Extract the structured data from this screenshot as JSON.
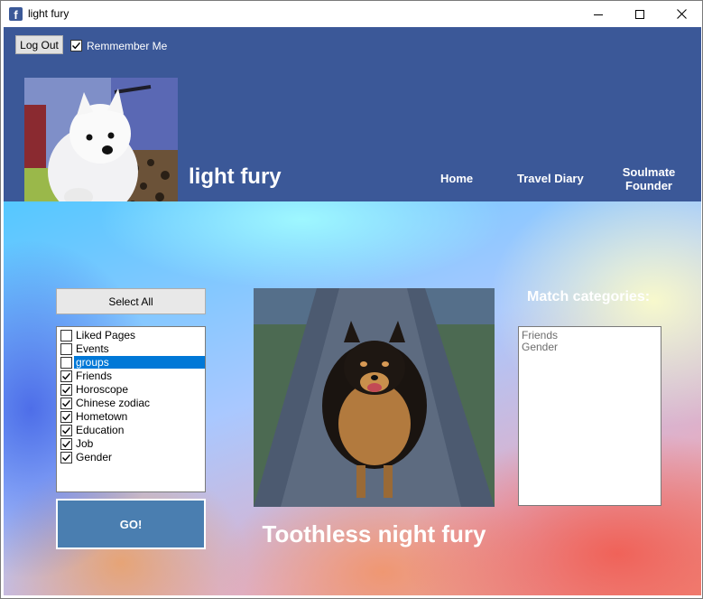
{
  "window": {
    "title": "light fury",
    "app_icon": "facebook-icon",
    "controls": [
      "minimize-icon",
      "maximize-icon",
      "close-icon"
    ]
  },
  "header": {
    "logout_label": "Log Out",
    "remember_label": "Remmember Me",
    "remember_checked": true,
    "profile_name": "light fury",
    "nav": [
      "Home",
      "Travel Diary",
      "Soulmate Founder"
    ]
  },
  "main": {
    "select_all_label": "Select All",
    "categories": [
      {
        "label": "Liked Pages",
        "checked": false,
        "selected": false
      },
      {
        "label": "Events",
        "checked": false,
        "selected": false
      },
      {
        "label": "groups",
        "checked": false,
        "selected": true
      },
      {
        "label": "Friends",
        "checked": true,
        "selected": false
      },
      {
        "label": "Horoscope",
        "checked": true,
        "selected": false
      },
      {
        "label": "Chinese zodiac",
        "checked": true,
        "selected": false
      },
      {
        "label": "Hometown",
        "checked": true,
        "selected": false
      },
      {
        "label": "Education",
        "checked": true,
        "selected": false
      },
      {
        "label": "Job",
        "checked": true,
        "selected": false
      },
      {
        "label": "Gender",
        "checked": true,
        "selected": false
      }
    ],
    "go_label": "GO!",
    "match_caption": "Toothless night fury",
    "match_categories_title": "Match categories:",
    "match_categories": [
      "Friends",
      "Gender"
    ]
  },
  "colors": {
    "header_bg": "#3b5898",
    "selection": "#0078d7",
    "go_button": "#4a7eb0"
  }
}
